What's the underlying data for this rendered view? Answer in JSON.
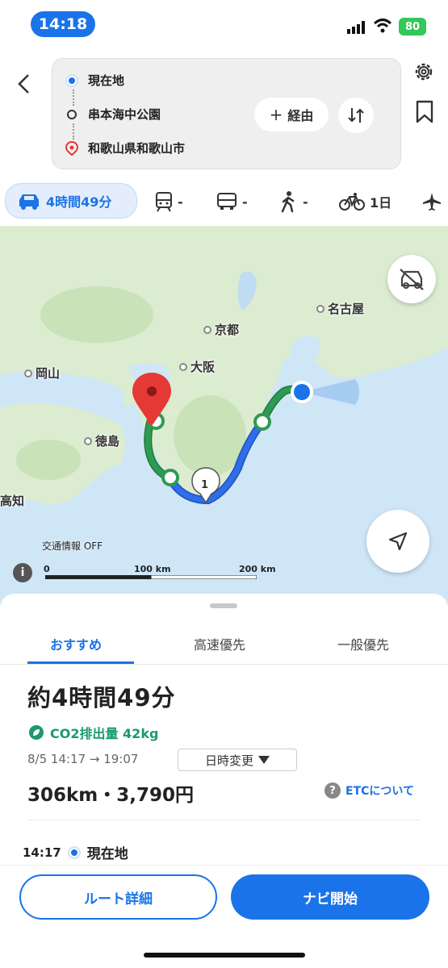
{
  "status_bar": {
    "time": "14:18",
    "battery": "80"
  },
  "route": {
    "origin": "現在地",
    "waypoint": "串本海中公園",
    "destination": "和歌山県和歌山市",
    "via_label": "経由"
  },
  "modes": {
    "car": "4時間49分",
    "train": "-",
    "bus": "-",
    "walk": "-",
    "bicycle": "1日"
  },
  "map": {
    "cities": {
      "nagoya": "名古屋",
      "kyoto": "京都",
      "osaka": "大阪",
      "okayama": "岡山",
      "tokushima": "徳島",
      "kochi": "高知"
    },
    "route_marker": "1",
    "traffic_label": "交通情報 OFF",
    "scale": {
      "start": "0",
      "mid": "100 km",
      "end": "200 km"
    },
    "colors": {
      "route_green": "#2e9b53",
      "route_blue": "#2f6ee8",
      "sea": "#cfe6f7",
      "land": "#dcecd0"
    }
  },
  "tabs": [
    "おすすめ",
    "高速優先",
    "一般優先"
  ],
  "summary": {
    "duration": "約4時間49分",
    "co2": "CO2排出量 42kg",
    "times": "8/5 14:17 → 19:07",
    "change_time": "日時変更",
    "distance": "306km・3,790円",
    "etc_link": "ETCについて"
  },
  "steps": [
    {
      "time": "14:17",
      "label": "現在地"
    }
  ],
  "actions": {
    "route_detail": "ルート詳細",
    "nav_start": "ナビ開始"
  }
}
